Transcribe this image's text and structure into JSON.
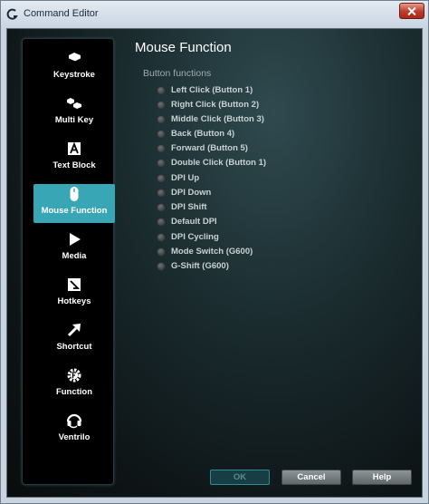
{
  "window": {
    "title": "Command Editor"
  },
  "sidebar": {
    "items": [
      {
        "label": "Keystroke",
        "icon": "keystroke-icon"
      },
      {
        "label": "Multi Key",
        "icon": "multi-key-icon"
      },
      {
        "label": "Text Block",
        "icon": "text-block-icon"
      },
      {
        "label": "Mouse Function",
        "icon": "mouse-icon",
        "active": true
      },
      {
        "label": "Media",
        "icon": "play-icon"
      },
      {
        "label": "Hotkeys",
        "icon": "hotkeys-icon"
      },
      {
        "label": "Shortcut",
        "icon": "shortcut-arrow-icon"
      },
      {
        "label": "Function",
        "icon": "function-gear-icon"
      },
      {
        "label": "Ventrilo",
        "icon": "ventrilo-headset-icon"
      }
    ]
  },
  "main": {
    "heading": "Mouse Function",
    "group_label": "Button functions",
    "options": [
      "Left Click (Button 1)",
      "Right Click (Button 2)",
      "Middle Click (Button 3)",
      "Back (Button 4)",
      "Forward (Button 5)",
      "Double Click (Button 1)",
      "DPI Up",
      "DPI Down",
      "DPI Shift",
      "Default DPI",
      "DPI Cycling",
      "Mode Switch (G600)",
      "G-Shift (G600)"
    ]
  },
  "footer": {
    "ok": "OK",
    "cancel": "Cancel",
    "help": "Help"
  },
  "colors": {
    "accent": "#39a6b5",
    "close": "#c0392b",
    "panel": "#000000"
  }
}
